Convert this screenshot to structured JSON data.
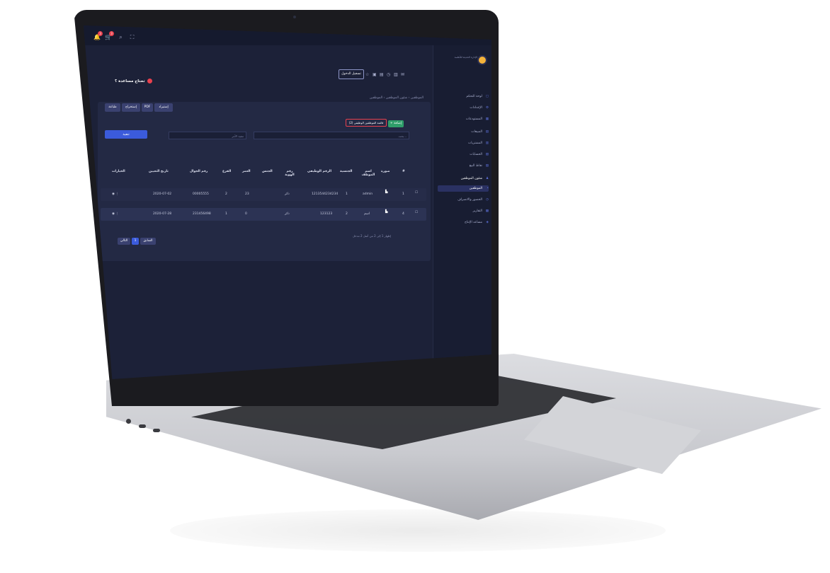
{
  "topbar": {
    "icons": [
      "bell-icon",
      "cart-icon",
      "search-icon",
      "fullscreen-icon"
    ],
    "badge_1": "3",
    "badge_2": "3"
  },
  "help": {
    "label": "تحتاج مساعدة ؟"
  },
  "toolbar": {
    "live_button": "تسجيل الدخول"
  },
  "breadcrumb": {
    "text": "الموظفين  ›  شئون الموظفين  ›  الموظفين"
  },
  "actions": {
    "import": "إستيراد",
    "pdf": "PDF",
    "export": "إستخراج",
    "print": "طباعة"
  },
  "list": {
    "title": "قائمة الموظفين الوظيفي (2)",
    "add": "+ إضافة"
  },
  "filters": {
    "search_placeholder": "بحث...",
    "select_value": "تنفيذ الأمر",
    "execute": "تنفيذ"
  },
  "table": {
    "headers": [
      "#",
      "صورة",
      "اسم الموظف",
      "الجنسية",
      "الرقم الوظيفي",
      "رقم الهوية",
      "الجنس",
      "العمر",
      "الفرع",
      "رقم الجوال",
      "تاريخ التعيين",
      "الخيارات"
    ],
    "rows": [
      {
        "num": "1",
        "name": "admin",
        "nationality": "1",
        "emp_no": "1213544234234",
        "id_no": "",
        "gender": "ذكر",
        "age": "23",
        "branch": "2",
        "phone": "00005555",
        "hire_date": "2020-07-02"
      },
      {
        "num": "4",
        "name": "اسم",
        "nationality": "2",
        "emp_no": "123123",
        "id_no": "",
        "gender": "ذكر",
        "age": "0",
        "branch": "1",
        "phone": "231456498",
        "hire_date": "2020-07-28"
      }
    ]
  },
  "pagination": {
    "showing": "إظهار 1 إلى 2 من أصل 2 مدخل",
    "prev": "السابق",
    "page": "1",
    "next": "التالي"
  },
  "sidebar": {
    "logo_text": "الإدارة الحديثة للأنظمة",
    "items": [
      "لوحة التحكم",
      "الإعدادات",
      "المستودعات",
      "المبيعات",
      "المشتريات",
      "الحسابات",
      "نقاط البيع",
      "شئون الموظفين",
      "الموظفين",
      "الحضور والانصراف",
      "التقارير",
      "مساعد الإنتاج"
    ],
    "footer": "WWW.ELARY.SA"
  }
}
